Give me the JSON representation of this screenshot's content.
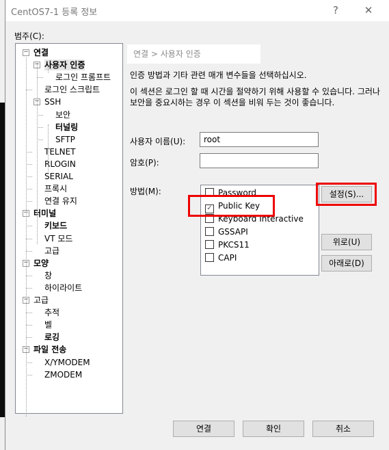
{
  "window": {
    "title": "CentOS7-1 등록 정보",
    "help": "?",
    "close": "✕"
  },
  "category_label": "범주(C):",
  "tree": [
    {
      "label": "연결",
      "level": 0,
      "bold": true,
      "expander": "−"
    },
    {
      "label": "사용자 인증",
      "level": 1,
      "bold": true,
      "selected": true,
      "expander": "−"
    },
    {
      "label": "로그인 프롬프트",
      "level": 2
    },
    {
      "label": "로그인 스크립트",
      "level": 1
    },
    {
      "label": "SSH",
      "level": 1,
      "expander": "−"
    },
    {
      "label": "보안",
      "level": 2
    },
    {
      "label": "터널링",
      "level": 2,
      "bold": true
    },
    {
      "label": "SFTP",
      "level": 2
    },
    {
      "label": "TELNET",
      "level": 1
    },
    {
      "label": "RLOGIN",
      "level": 1
    },
    {
      "label": "SERIAL",
      "level": 1
    },
    {
      "label": "프록시",
      "level": 1
    },
    {
      "label": "연결 유지",
      "level": 1
    },
    {
      "label": "터미널",
      "level": 0,
      "bold": true,
      "expander": "−"
    },
    {
      "label": "키보드",
      "level": 1,
      "bold": true
    },
    {
      "label": "VT 모드",
      "level": 1
    },
    {
      "label": "고급",
      "level": 1
    },
    {
      "label": "모양",
      "level": 0,
      "bold": true,
      "expander": "−"
    },
    {
      "label": "창",
      "level": 1
    },
    {
      "label": "하이라이트",
      "level": 1
    },
    {
      "label": "고급",
      "level": 0,
      "expander": "−"
    },
    {
      "label": "추적",
      "level": 1
    },
    {
      "label": "벨",
      "level": 1
    },
    {
      "label": "로깅",
      "level": 1,
      "bold": true
    },
    {
      "label": "파일 전송",
      "level": 0,
      "bold": true,
      "expander": "−"
    },
    {
      "label": "X/YMODEM",
      "level": 1
    },
    {
      "label": "ZMODEM",
      "level": 1
    }
  ],
  "main": {
    "breadcrumb": "연결 > 사용자 인증",
    "desc1": "인증 방법과 기타 관련 매개 변수들을 선택하십시오.",
    "desc2": "이 섹션은 로그인 할 때 시간을 절약하기 위해 사용할 수 있습니다. 그러나 보안을 중요시하는 경우 이 섹션을 비워 두는 것이 좋습니다.",
    "username_label": "사용자 이름(U):",
    "username_value": "root",
    "password_label": "암호(P):",
    "password_value": "",
    "method_label": "방법(M):",
    "methods": [
      {
        "label": "Password",
        "checked": false
      },
      {
        "label": "Public Key",
        "checked": true
      },
      {
        "label": "Keyboard Interactive",
        "checked": false
      },
      {
        "label": "GSSAPI",
        "checked": false
      },
      {
        "label": "PKCS11",
        "checked": false
      },
      {
        "label": "CAPI",
        "checked": false
      }
    ],
    "settings_button": "설정(S)...",
    "up_button": "위로(U)",
    "down_button": "아래로(D)"
  },
  "footer": {
    "connect": "연결",
    "ok": "확인",
    "cancel": "취소"
  },
  "colors": {
    "highlight": "#e00000"
  }
}
